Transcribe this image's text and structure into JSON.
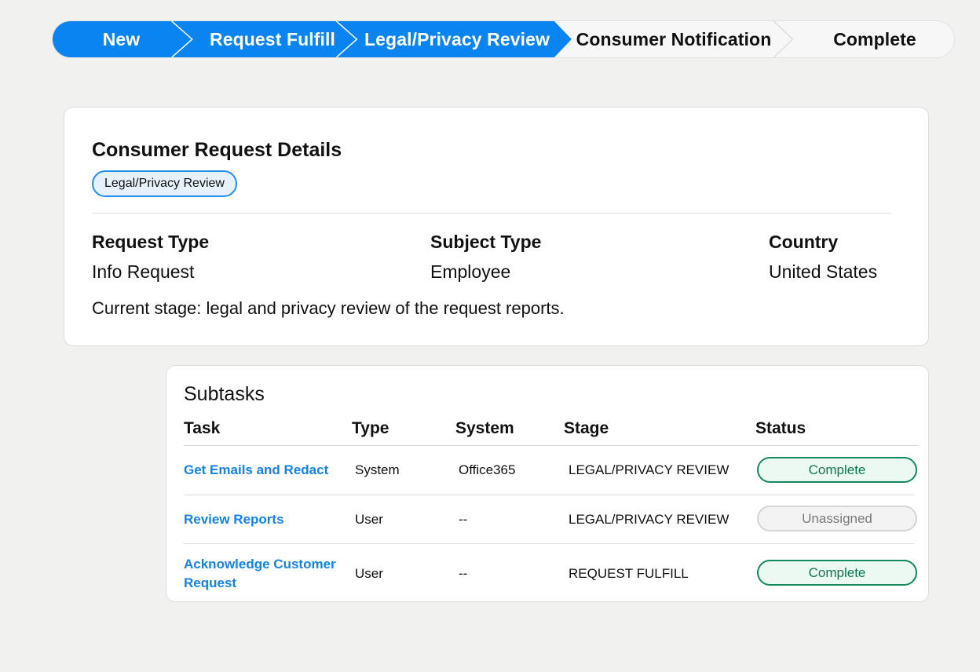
{
  "path": {
    "steps": [
      {
        "label": "New",
        "state": "done"
      },
      {
        "label": "Request Fulfill",
        "state": "done"
      },
      {
        "label": "Legal/Privacy Review",
        "state": "current"
      },
      {
        "label": "Consumer Notification",
        "state": "todo"
      },
      {
        "label": "Complete",
        "state": "todo"
      }
    ]
  },
  "details": {
    "title": "Consumer Request Details",
    "badge": "Legal/Privacy Review",
    "fields": [
      {
        "label": "Request Type",
        "value": "Info Request"
      },
      {
        "label": "Subject Type",
        "value": "Employee"
      },
      {
        "label": "Country",
        "value": "United States"
      }
    ],
    "note": "Current stage: legal and privacy review of the request reports."
  },
  "subtasks": {
    "title": "Subtasks",
    "columns": [
      "Task",
      "Type",
      "System",
      "Stage",
      "Status"
    ],
    "rows": [
      {
        "task": "Get Emails and Redact",
        "type": "System",
        "system": "Office365",
        "stage": "LEGAL/PRIVACY REVIEW",
        "status": "Complete"
      },
      {
        "task": "Review Reports",
        "type": "User",
        "system": "--",
        "stage": "LEGAL/PRIVACY REVIEW",
        "status": "Unassigned"
      },
      {
        "task": "Acknowledge Customer Request",
        "type": "User",
        "system": "--",
        "stage": "REQUEST FULFILL",
        "status": "Complete"
      }
    ]
  },
  "colors": {
    "accent": "#0a84f0",
    "complete": "#128a5c",
    "unassigned": "#d4d4d4"
  }
}
